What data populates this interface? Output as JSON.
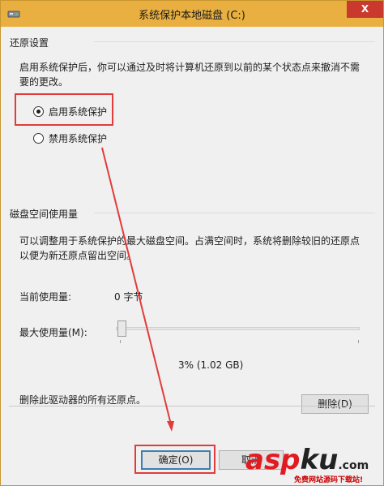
{
  "window": {
    "title": "系统保护本地磁盘 (C:)",
    "close_glyph": "X"
  },
  "restore": {
    "section_title": "还原设置",
    "desc_line1": "启用系统保护后，你可以通过及时将计算机还原到以前的某个状态点来撤消不需",
    "desc_line2": "要的更改。",
    "options": [
      {
        "label": "启用系统保护",
        "checked": true
      },
      {
        "label": "禁用系统保护",
        "checked": false
      }
    ]
  },
  "disk": {
    "section_title": "磁盘空间使用量",
    "desc_line1": "可以调整用于系统保护的最大磁盘空间。占满空间时，系统将删除较旧的还原点",
    "desc_line2": "以便为新还原点留出空间。",
    "current_label": "当前使用量:",
    "current_value": "0 字节",
    "max_label": "最大使用量(M):",
    "slider_fraction": 0.03,
    "max_value": "3% (1.02 GB)",
    "delete_text": "删除此驱动器的所有还原点。",
    "delete_button": "删除(D)"
  },
  "footer": {
    "ok_button": "确定(O)",
    "cancel_button": "取消"
  },
  "watermark": {
    "brand_a": "asp",
    "brand_b": "ku",
    "suffix": ".com",
    "subtitle": "免费网站源码下载站!"
  },
  "colors": {
    "title_bar": "#e9b041",
    "close": "#c9392d",
    "highlight": "#e23b3b",
    "wm_red": "#e11b22",
    "wm_dark": "#222222"
  }
}
